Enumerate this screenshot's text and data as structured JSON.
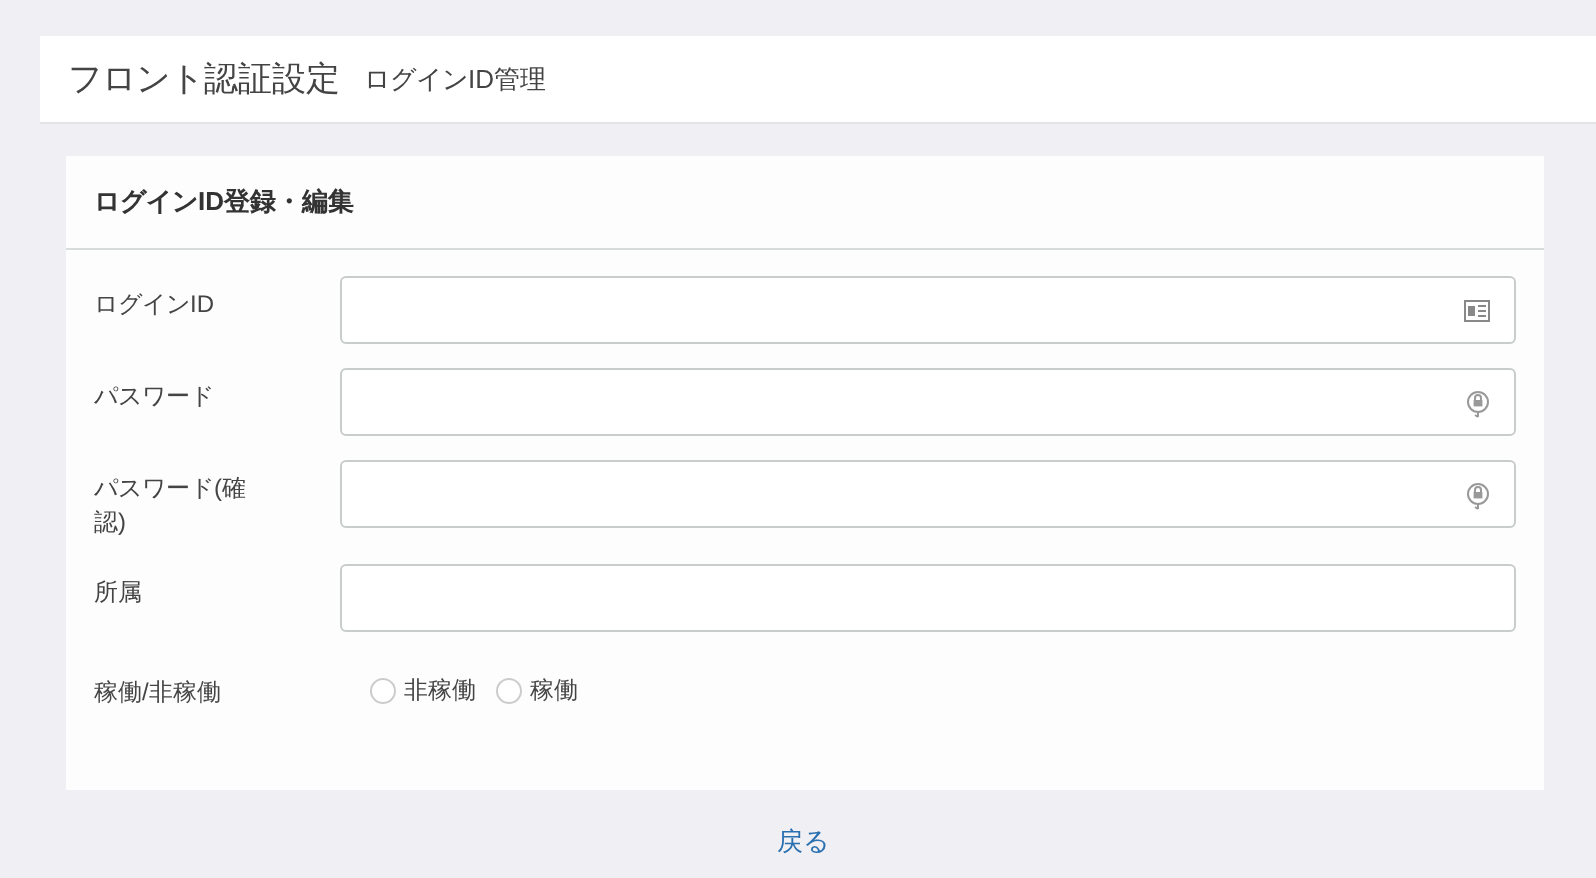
{
  "header": {
    "title": "フロント認証設定",
    "subtitle": "ログインID管理"
  },
  "card": {
    "title": "ログインID登録・編集",
    "fields": [
      {
        "kind": "id_input",
        "label": "ログインID"
      },
      {
        "kind": "password_input",
        "label": "パスワード"
      },
      {
        "kind": "password_input",
        "label": "パスワード(確認)"
      },
      {
        "kind": "input",
        "label": "所属"
      },
      {
        "kind": "radio",
        "label": "稼働/非稼働",
        "options": [
          {
            "label": "非稼働",
            "selected": false
          },
          {
            "label": "稼働",
            "selected": false
          }
        ]
      }
    ]
  },
  "back_link": "戻る"
}
